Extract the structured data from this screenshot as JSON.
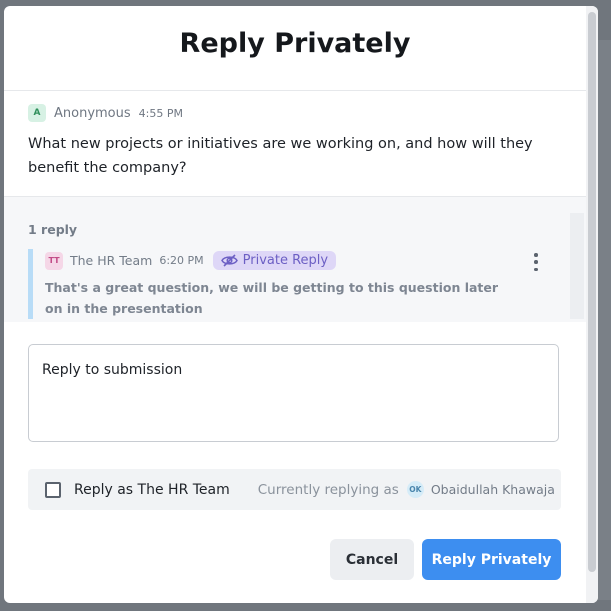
{
  "modal": {
    "title": "Reply Privately"
  },
  "submission": {
    "avatar_initials": "A",
    "author": "Anonymous",
    "time": "4:55 PM",
    "text": "What new projects or initiatives are we working on, and how will they benefit the company?"
  },
  "thread": {
    "reply_count": "1 reply",
    "replies": [
      {
        "avatar_initials": "TT",
        "author": "The HR Team",
        "time": "6:20 PM",
        "badge": "Private Reply",
        "badge_icon": "eye-off-icon",
        "text": "That's a great question, we will be getting to this question later on in the presentation"
      }
    ]
  },
  "reply_input": {
    "placeholder": "Reply to submission",
    "value": ""
  },
  "reply_as": {
    "checkbox_label": "Reply as The HR Team",
    "checked": false,
    "currently_label": "Currently replying as",
    "user_initials": "OK",
    "user_name": "Obaidullah Khawaja"
  },
  "actions": {
    "cancel_label": "Cancel",
    "submit_label": "Reply Privately"
  },
  "colors": {
    "primary": "#3d8ef0",
    "private_badge_bg": "#ded7f7",
    "private_badge_fg": "#6c5fc4",
    "thread_accent": "#b8dcf7"
  }
}
